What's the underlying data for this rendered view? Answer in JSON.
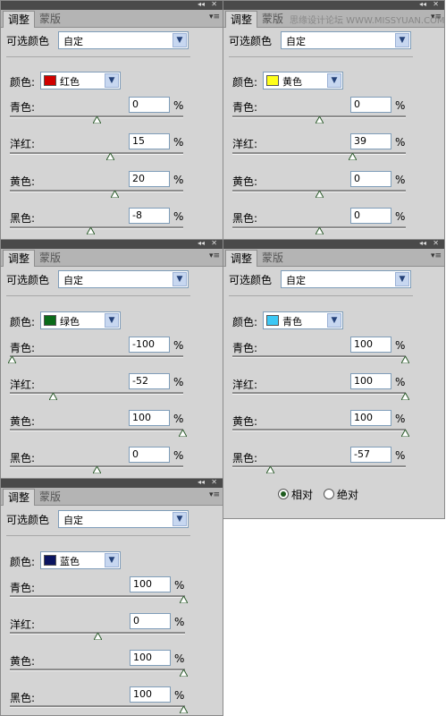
{
  "common": {
    "tab_adjust": "调整",
    "tab_mask": "蒙版",
    "preset_label": "可选颜色",
    "preset_value": "自定",
    "color_label": "颜色:",
    "percent": "%",
    "collapse_glyph": "◂◂",
    "close_glyph": "✕",
    "menu_glyph": "▾≡"
  },
  "watermark": "思缘设计论坛 WWW.MISSYUAN.COM",
  "channel_labels": {
    "cyan": "青色:",
    "magenta": "洋红:",
    "yellow": "黄色:",
    "black": "黑色:"
  },
  "panels": [
    {
      "color_name": "红色",
      "swatch": "#d00000",
      "values": {
        "cyan": "0",
        "magenta": "15",
        "yellow": "20",
        "black": "-8"
      }
    },
    {
      "color_name": "黄色",
      "swatch": "#ffff1a",
      "values": {
        "cyan": "0",
        "magenta": "39",
        "yellow": "0",
        "black": "0"
      }
    },
    {
      "color_name": "绿色",
      "swatch": "#0a6b1a",
      "values": {
        "cyan": "-100",
        "magenta": "-52",
        "yellow": "100",
        "black": "0"
      }
    },
    {
      "color_name": "青色",
      "swatch": "#3cc8f5",
      "values": {
        "cyan": "100",
        "magenta": "100",
        "yellow": "100",
        "black": "-57"
      }
    },
    {
      "color_name": "蓝色",
      "swatch": "#0a1460",
      "values": {
        "cyan": "100",
        "magenta": "0",
        "yellow": "100",
        "black": "100"
      }
    }
  ],
  "method": {
    "relative": "相对",
    "absolute": "绝对",
    "selected": "relative"
  }
}
